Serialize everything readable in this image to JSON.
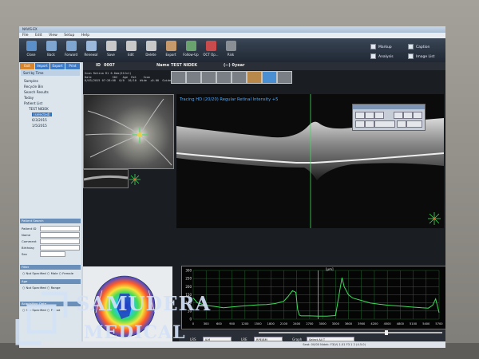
{
  "window": {
    "title": "NAVIS-EX"
  },
  "menu": [
    "File",
    "Edit",
    "View",
    "Setup",
    "Help"
  ],
  "toolbar": {
    "buttons": [
      {
        "label": "Close",
        "icon": "close-icon",
        "color": "#5b8fc9"
      },
      {
        "label": "Back",
        "icon": "back-icon",
        "color": "#7fa6d1"
      },
      {
        "label": "Forward",
        "icon": "forward-icon",
        "color": "#7fa6d1"
      },
      {
        "label": "Renewal",
        "icon": "renewal-icon",
        "color": "#9bb9db"
      },
      {
        "label": "Save",
        "icon": "save-icon",
        "color": "#c9c9c9"
      },
      {
        "label": "Edit",
        "icon": "edit-icon",
        "color": "#c9c9c9"
      },
      {
        "label": "Delete",
        "icon": "delete-icon",
        "color": "#c9c9c9"
      },
      {
        "label": "Export",
        "icon": "export-icon",
        "color": "#c79a6b"
      },
      {
        "label": "Follow-Up",
        "icon": "follow-up-icon",
        "color": "#6aa36e"
      },
      {
        "label": "OCT Op...",
        "icon": "oct-options-icon",
        "color": "#c94b4b"
      },
      {
        "label": "Risk",
        "icon": "risk-icon",
        "color": "#8a8f96"
      }
    ],
    "checks": [
      "Markup",
      "Analysis",
      "Caption",
      "Image List"
    ]
  },
  "left_panel": {
    "tabs": [
      "Exit",
      "Import",
      "Export",
      "Print"
    ],
    "sort_label": "Sort by Time",
    "tree": [
      "Samples",
      "Recycle Bin",
      "Search Results",
      "Today",
      "Patient List",
      "TEST NIDEK",
      "(selected)",
      "6/3/2015",
      "1/5/2015"
    ],
    "search_title": "Patient Search",
    "search_fields": [
      "Patient ID",
      "Name",
      "Comment",
      "Birthday",
      "Sex"
    ],
    "filter_title": "Filter",
    "filter_options": [
      "Not Specified",
      "Male",
      "Female"
    ],
    "age_title": "Age",
    "age_options": [
      "Not Specified",
      "Range"
    ],
    "acq_title": "Acquisition Date",
    "acq_options": [
      "Not Specified",
      "Period"
    ]
  },
  "main": {
    "patient_id_label": "ID",
    "patient_id": "0007",
    "name_label": "Name",
    "patient_name": "TEST NIDEK",
    "patient_age": "(--) 0year",
    "header_text": "Scan Retina R1 6.0mm(512x1)\nDate            S02   Age  Ret    Scan\n6/03/2015 07:28:08  0/0  10/10  Wide  +0.00  Guidelines",
    "scan_caption": "Tracing HD (20/20) Regular Retinal Intensity +5",
    "graph_unit": "[µm]",
    "controls": {
      "layer_label": "LRS",
      "layer_value": "ILM",
      "lower_label": "LRE",
      "lower_value": "RPE/BM",
      "graph_label": "Graph",
      "graph_value": "Select All T"
    }
  },
  "statusbar": {
    "left": "",
    "right": "Seat: 00/00   Nidek: F3(V)   1.01  F3 1 2 (4.5.0)"
  },
  "watermark": {
    "line1": "SAMUDERA",
    "line2": "MEDICAL"
  },
  "chart_data": {
    "type": "line",
    "xlabel": "",
    "ylabel": "[µm]",
    "xlim": [
      0,
      5700
    ],
    "ylim": [
      0,
      300
    ],
    "x_ticks": [
      0,
      300,
      600,
      900,
      1200,
      1500,
      1800,
      2100,
      2400,
      2700,
      3000,
      3300,
      3600,
      3900,
      4200,
      4500,
      4800,
      5100,
      5400,
      5700
    ],
    "y_ticks": [
      0,
      50,
      100,
      150,
      200,
      250,
      300
    ],
    "series": [
      {
        "color": "#3fdc5a",
        "x": [
          0,
          100,
          300,
          500,
          700,
          900,
          1100,
          1300,
          1500,
          1700,
          1900,
          2100,
          2200,
          2300,
          2380,
          2420,
          2460,
          2500,
          2700,
          2900,
          3100,
          3300,
          3400,
          3450,
          3500,
          3600,
          3700,
          3900,
          4100,
          4300,
          4500,
          4700,
          4900,
          5100,
          5300,
          5450,
          5550,
          5620,
          5700
        ],
        "y": [
          130,
          100,
          85,
          78,
          70,
          75,
          80,
          84,
          88,
          90,
          96,
          110,
          140,
          175,
          165,
          60,
          25,
          20,
          20,
          18,
          18,
          22,
          180,
          255,
          200,
          150,
          130,
          115,
          100,
          92,
          86,
          82,
          78,
          74,
          70,
          68,
          85,
          125,
          40
        ]
      }
    ]
  }
}
